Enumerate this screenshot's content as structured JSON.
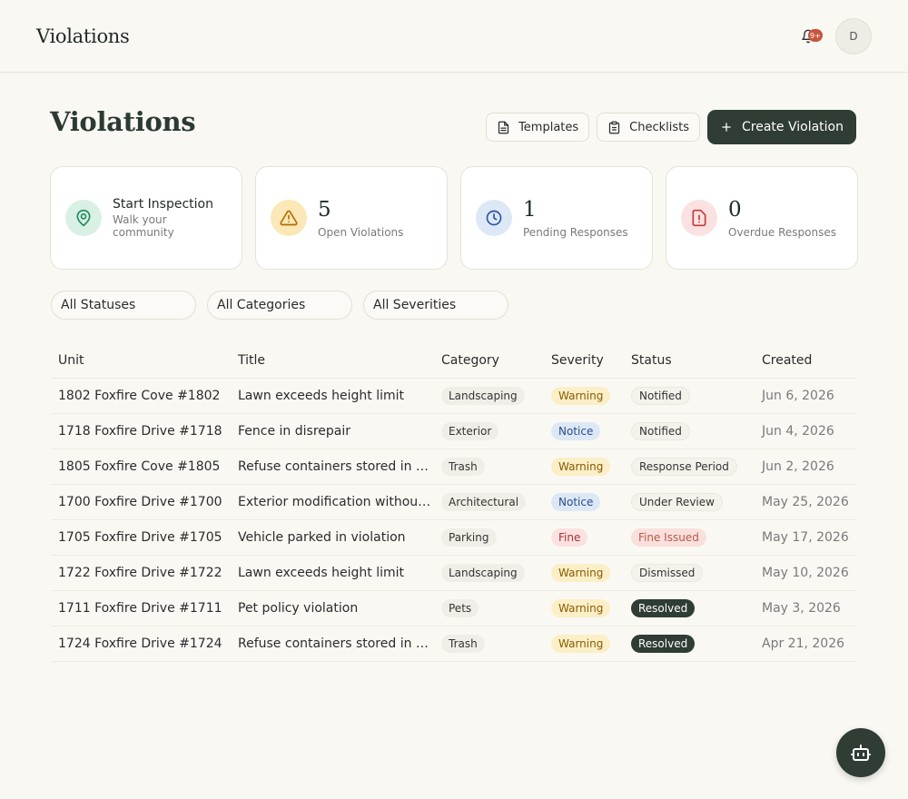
{
  "header": {
    "brand": "Violations",
    "notification_count": "9+",
    "avatar_initial": "D"
  },
  "page": {
    "title": "Violations"
  },
  "actions": {
    "templates": "Templates",
    "checklists": "Checklists",
    "create": "Create Violation"
  },
  "stats": {
    "inspection": {
      "title": "Start Inspection",
      "subtitle": "Walk your community"
    },
    "open": {
      "value": "5",
      "label": "Open Violations"
    },
    "pending": {
      "value": "1",
      "label": "Pending Responses"
    },
    "overdue": {
      "value": "0",
      "label": "Overdue Responses"
    }
  },
  "filters": {
    "status": "All Statuses",
    "category": "All Categories",
    "severity": "All Severities"
  },
  "table": {
    "columns": [
      "Unit",
      "Title",
      "Category",
      "Severity",
      "Status",
      "Created"
    ],
    "rows": [
      {
        "unit": "1802 Foxfire Cove #1802",
        "title": "Lawn exceeds height limit",
        "category": "Landscaping",
        "severity": "Warning",
        "status": "Notified",
        "created": "Jun 6, 2026"
      },
      {
        "unit": "1718 Foxfire Drive #1718",
        "title": "Fence in disrepair",
        "category": "Exterior",
        "severity": "Notice",
        "status": "Notified",
        "created": "Jun 4, 2026"
      },
      {
        "unit": "1805 Foxfire Cove #1805",
        "title": "Refuse containers stored in vie...",
        "category": "Trash",
        "severity": "Warning",
        "status": "Response Period",
        "created": "Jun 2, 2026"
      },
      {
        "unit": "1700 Foxfire Drive #1700",
        "title": "Exterior modification without ...",
        "category": "Architectural",
        "severity": "Notice",
        "status": "Under Review",
        "created": "May 25, 2026"
      },
      {
        "unit": "1705 Foxfire Drive #1705",
        "title": "Vehicle parked in violation",
        "category": "Parking",
        "severity": "Fine",
        "status": "Fine Issued",
        "created": "May 17, 2026"
      },
      {
        "unit": "1722 Foxfire Drive #1722",
        "title": "Lawn exceeds height limit",
        "category": "Landscaping",
        "severity": "Warning",
        "status": "Dismissed",
        "created": "May 10, 2026"
      },
      {
        "unit": "1711 Foxfire Drive #1711",
        "title": "Pet policy violation",
        "category": "Pets",
        "severity": "Warning",
        "status": "Resolved",
        "created": "May 3, 2026"
      },
      {
        "unit": "1724 Foxfire Drive #1724",
        "title": "Refuse containers stored in vie...",
        "category": "Trash",
        "severity": "Warning",
        "status": "Resolved",
        "created": "Apr 21, 2026"
      }
    ]
  },
  "icons": {
    "bell": "bell-icon",
    "templates": "document-icon",
    "checklists": "clipboard-icon",
    "create": "plus-icon",
    "inspection": "map-pin-icon",
    "open": "warning-triangle-icon",
    "pending": "clock-icon",
    "overdue": "alert-file-icon",
    "fab": "robot-icon"
  },
  "colors": {
    "primary": "#2f3d34",
    "background": "#faf8f3",
    "warning": "#fbefc8",
    "notice": "#dde8f7",
    "fine": "#fbe1e1",
    "badge": "#c8553d"
  }
}
